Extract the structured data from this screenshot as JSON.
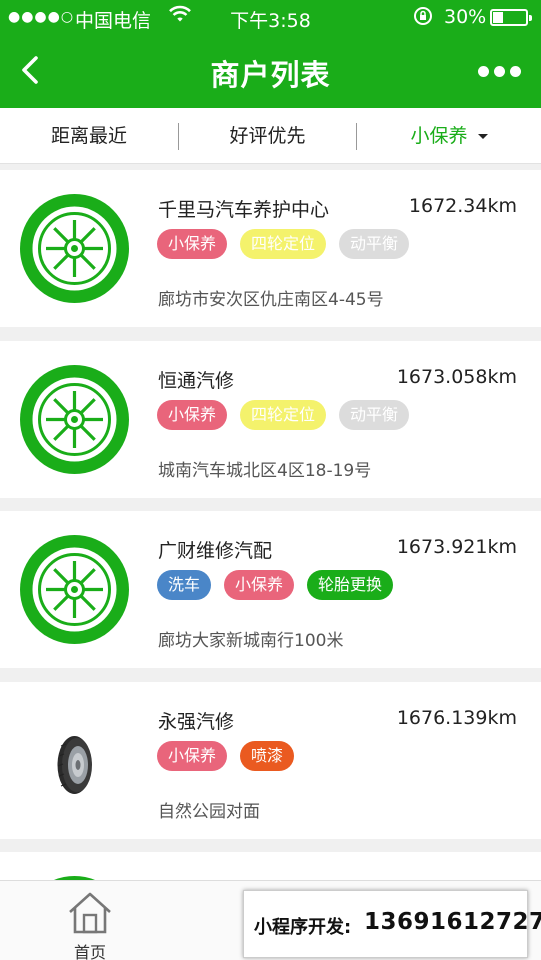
{
  "status_bar": {
    "signal": "●●●●○",
    "carrier": "中国电信",
    "wifi_icon": "wifi-icon",
    "time": "下午3:58",
    "rotation_lock_icon": "rotation-lock-icon",
    "battery_percent": "30%",
    "battery_level": 0.3
  },
  "nav": {
    "title": "商户列表",
    "back_icon": "chevron-left-icon",
    "more_icon": "more-dots-icon"
  },
  "filter": {
    "tabs": [
      {
        "label": "距离最近"
      },
      {
        "label": "好评优先"
      },
      {
        "label": "小保养"
      }
    ],
    "active_index": 2
  },
  "merchants": [
    {
      "name": "千里马汽车养护中心",
      "distance": "1672.34km",
      "logo": "green-wheel",
      "tags": [
        {
          "label": "小保养",
          "color": "#e9657b"
        },
        {
          "label": "四轮定位",
          "color": "#f4f26c"
        },
        {
          "label": "动平衡",
          "color": "#dcdcdc"
        }
      ],
      "address": "廊坊市安次区仇庄南区4-45号"
    },
    {
      "name": "恒通汽修",
      "distance": "1673.058km",
      "logo": "green-wheel",
      "tags": [
        {
          "label": "小保养",
          "color": "#e9657b"
        },
        {
          "label": "四轮定位",
          "color": "#f4f26c"
        },
        {
          "label": "动平衡",
          "color": "#dcdcdc"
        }
      ],
      "address": "城南汽车城北区4区18-19号"
    },
    {
      "name": "广财维修汽配",
      "distance": "1673.921km",
      "logo": "green-wheel",
      "tags": [
        {
          "label": "洗车",
          "color": "#4a86c8"
        },
        {
          "label": "小保养",
          "color": "#e9657b"
        },
        {
          "label": "轮胎更换",
          "color": "#1aad19"
        }
      ],
      "address": "廊坊大家新城南行100米"
    },
    {
      "name": "永强汽修",
      "distance": "1676.139km",
      "logo": "tire-photo",
      "tags": [
        {
          "label": "小保养",
          "color": "#e9657b"
        },
        {
          "label": "喷漆",
          "color": "#ea5a20"
        }
      ],
      "address": "自然公园对面"
    }
  ],
  "tabbar": {
    "items": [
      {
        "label": "首页",
        "icon": "home-icon"
      }
    ]
  },
  "promo": {
    "label": "小程序开发:",
    "phone": "13691612727"
  },
  "colors": {
    "brand_green": "#1aad19"
  }
}
